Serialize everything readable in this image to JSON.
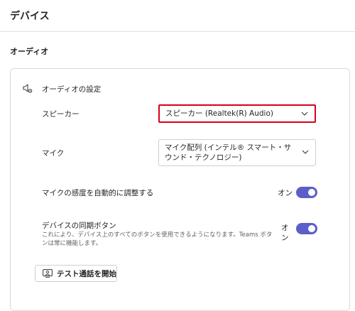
{
  "page": {
    "title": "デバイス"
  },
  "audio_section": {
    "title": "オーディオ",
    "card": {
      "header": "オーディオの設定",
      "speaker": {
        "label": "スピーカー",
        "value": "スピーカー (Realtek(R) Audio)"
      },
      "mic": {
        "label": "マイク",
        "value": "マイク配列 (インテル® スマート・サウンド・テクノロジー)"
      },
      "auto_adjust": {
        "label": "マイクの感度を自動的に調整する",
        "state_label": "オン",
        "on": true
      },
      "device_sync": {
        "label": "デバイスの同期ボタン",
        "description": "これにより、デバイス上のすべてのボタンを使用できるようになります。Teams ボタンは常に機能します。",
        "state_label": "オン",
        "on": true
      },
      "test_call_button": {
        "label": "テスト通話を開始"
      }
    }
  },
  "colors": {
    "toggle_on": "#5b5fc7",
    "highlight_border": "#d6001c"
  },
  "icons": {
    "header": "audio-settings-icon",
    "dropdown": "chevron-down-icon",
    "test_call": "test-call-icon"
  }
}
